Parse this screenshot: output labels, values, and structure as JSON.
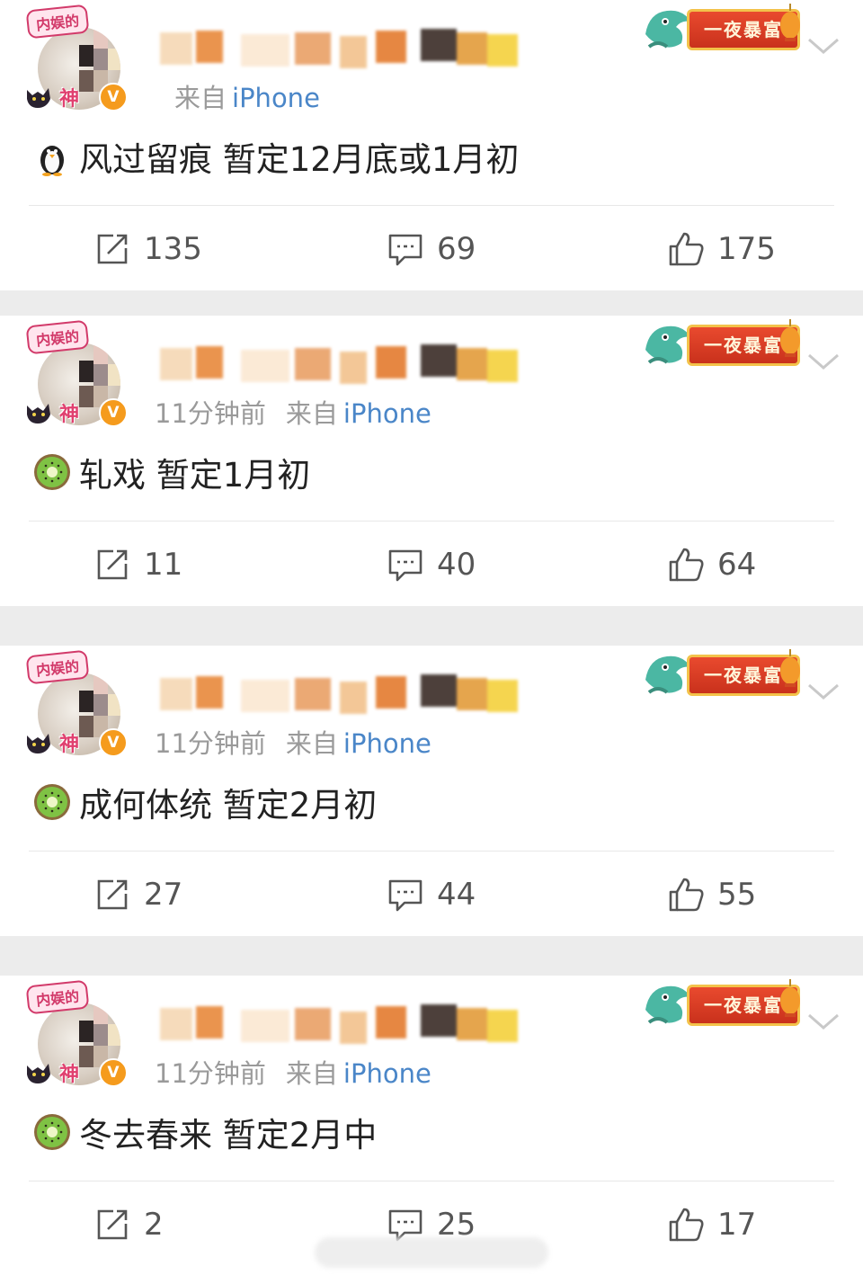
{
  "colors": {
    "link_blue": "#4a86c8",
    "meta_gray": "#9a9a9a",
    "text_dark": "#222222",
    "action_gray": "#555555",
    "verified_orange": "#f59b1d",
    "banner_red": "#d93a22"
  },
  "posts": [
    {
      "avatar_badge_top": "内娱的",
      "avatar_badge_bottom": "神",
      "verified_mark": "V",
      "time": "",
      "source_label": "来自",
      "source_device": "iPhone",
      "banner_text": "一夜暴富",
      "emoji_icon": "penguin-icon",
      "text": "风过留痕 暂定12月底或1月初",
      "reposts": "135",
      "comments": "69",
      "likes": "175"
    },
    {
      "avatar_badge_top": "内娱的",
      "avatar_badge_bottom": "神",
      "verified_mark": "V",
      "time": "11分钟前",
      "source_label": "来自",
      "source_device": "iPhone",
      "banner_text": "一夜暴富",
      "emoji_icon": "kiwi-icon",
      "text": "轧戏 暂定1月初",
      "reposts": "11",
      "comments": "40",
      "likes": "64"
    },
    {
      "avatar_badge_top": "内娱的",
      "avatar_badge_bottom": "神",
      "verified_mark": "V",
      "time": "11分钟前",
      "source_label": "来自",
      "source_device": "iPhone",
      "banner_text": "一夜暴富",
      "emoji_icon": "kiwi-icon",
      "text": "成何体统 暂定2月初",
      "reposts": "27",
      "comments": "44",
      "likes": "55"
    },
    {
      "avatar_badge_top": "内娱的",
      "avatar_badge_bottom": "神",
      "verified_mark": "V",
      "time": "11分钟前",
      "source_label": "来自",
      "source_device": "iPhone",
      "banner_text": "一夜暴富",
      "emoji_icon": "kiwi-icon",
      "text": "冬去春来 暂定2月中",
      "reposts": "2",
      "comments": "25",
      "likes": "17"
    }
  ]
}
